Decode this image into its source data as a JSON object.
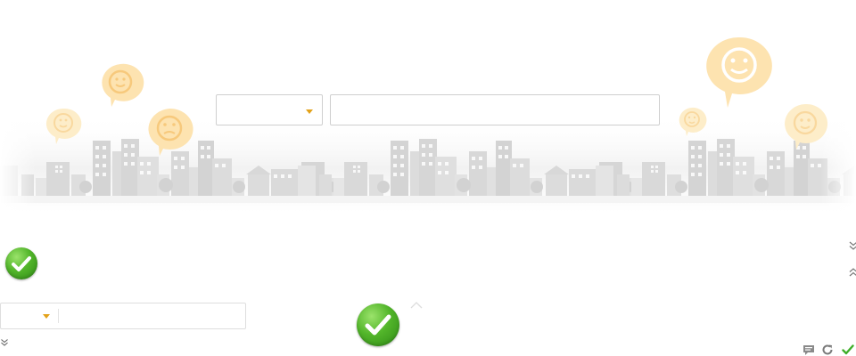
{
  "colors": {
    "accent_orange": "#e3a21a",
    "smiley_fill": "#fde3b0",
    "smiley_fill_light": "#fdedc9",
    "city_gray": "#d9d9d9",
    "check_green": "#52b52a",
    "border_gray": "#cfcfcf"
  },
  "hero": {
    "illustration": "city-skyline-with-smiley-bubbles"
  },
  "search": {
    "category_value": "",
    "query_value": "",
    "query_placeholder": ""
  },
  "mini_search": {
    "category_value": "",
    "query_value": "",
    "query_placeholder": ""
  },
  "icons": {
    "dropdown": "caret-down-icon",
    "check": "check-icon",
    "expand": "double-chevron-down-icon",
    "collapse": "double-chevron-up-icon",
    "caret_up": "caret-up-icon",
    "comment": "comment-icon",
    "refresh": "refresh-icon",
    "confirm": "check-icon"
  }
}
